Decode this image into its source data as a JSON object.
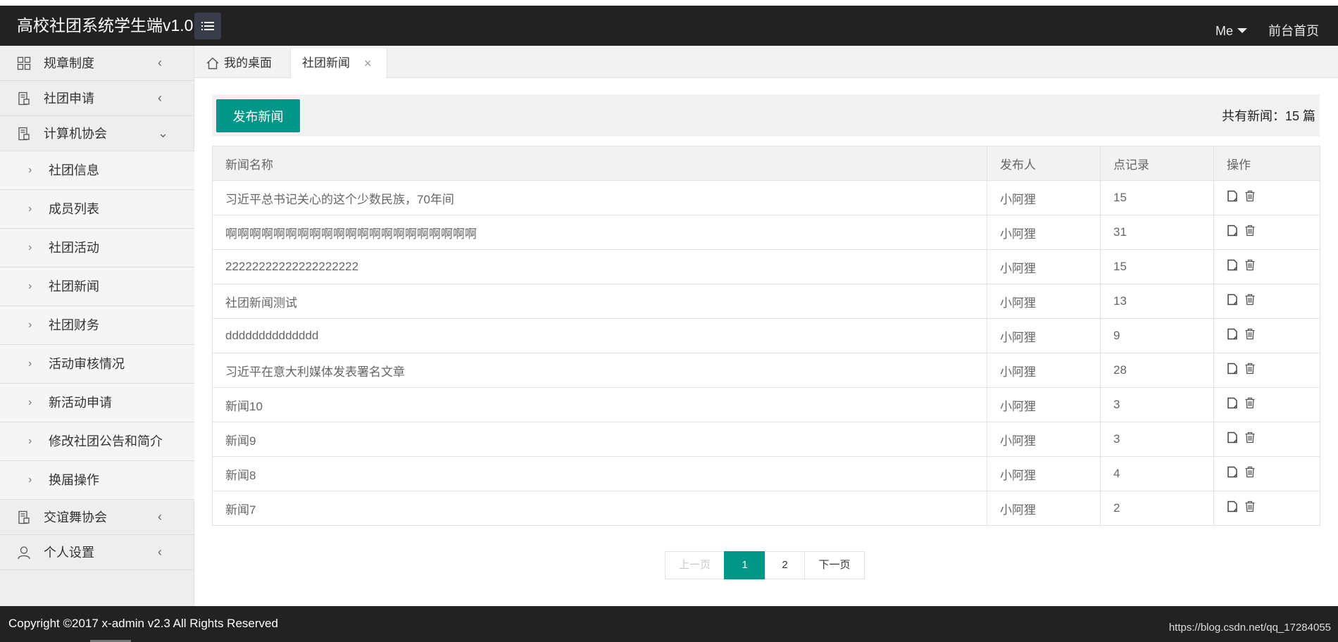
{
  "header": {
    "title": "高校社团系统学生端v1.0",
    "me_label": "Me",
    "home_label": "前台首页"
  },
  "sidebar": {
    "groups": [
      {
        "label": "规章制度",
        "icon": "grid-icon",
        "arrow": "<"
      },
      {
        "label": "社团申请",
        "icon": "document-icon",
        "arrow": "<"
      },
      {
        "label": "计算机协会",
        "icon": "document-icon",
        "arrow": "v"
      },
      {
        "label": "交谊舞协会",
        "icon": "document-icon",
        "arrow": "<"
      },
      {
        "label": "个人设置",
        "icon": "user-icon",
        "arrow": "<"
      }
    ],
    "sub_items": [
      {
        "label": "社团信息"
      },
      {
        "label": "成员列表"
      },
      {
        "label": "社团活动"
      },
      {
        "label": "社团新闻"
      },
      {
        "label": "社团财务"
      },
      {
        "label": "活动审核情况"
      },
      {
        "label": "新活动申请"
      },
      {
        "label": "修改社团公告和简介"
      },
      {
        "label": "换届操作"
      }
    ]
  },
  "tabs": [
    {
      "label": "我的桌面",
      "icon": "home-icon"
    },
    {
      "label": "社团新闻",
      "close": "×"
    }
  ],
  "toolbar": {
    "publish_label": "发布新闻",
    "total_text": "共有新闻：15 篇"
  },
  "table": {
    "headers": [
      "新闻名称",
      "发布人",
      "点记录",
      "操作"
    ],
    "rows": [
      {
        "name": "习近平总书记关心的这个少数民族，70年间",
        "author": "小阿狸",
        "clicks": "15"
      },
      {
        "name": "啊啊啊啊啊啊啊啊啊啊啊啊啊啊啊啊啊啊啊啊啊",
        "author": "小阿狸",
        "clicks": "31"
      },
      {
        "name": "22222222222222222222",
        "author": "小阿狸",
        "clicks": "15"
      },
      {
        "name": "社团新闻测试",
        "author": "小阿狸",
        "clicks": "13"
      },
      {
        "name": "dddddddddddddd",
        "author": "小阿狸",
        "clicks": "9"
      },
      {
        "name": "习近平在意大利媒体发表署名文章",
        "author": "小阿狸",
        "clicks": "28"
      },
      {
        "name": "新闻10",
        "author": "小阿狸",
        "clicks": "3"
      },
      {
        "name": "新闻9",
        "author": "小阿狸",
        "clicks": "3"
      },
      {
        "name": "新闻8",
        "author": "小阿狸",
        "clicks": "4"
      },
      {
        "name": "新闻7",
        "author": "小阿狸",
        "clicks": "2"
      }
    ]
  },
  "pagination": {
    "prev_label": "上一页",
    "pages": [
      "1",
      "2"
    ],
    "current": "1",
    "next_label": "下一页"
  },
  "footer": {
    "copyright": "Copyright ©2017 x-admin v2.3 All Rights Reserved",
    "watermark": "https://blog.csdn.net/qq_17284055"
  },
  "colors": {
    "accent": "#009688",
    "header_bg": "#222222",
    "sidebar_bg": "#eeeeee"
  }
}
